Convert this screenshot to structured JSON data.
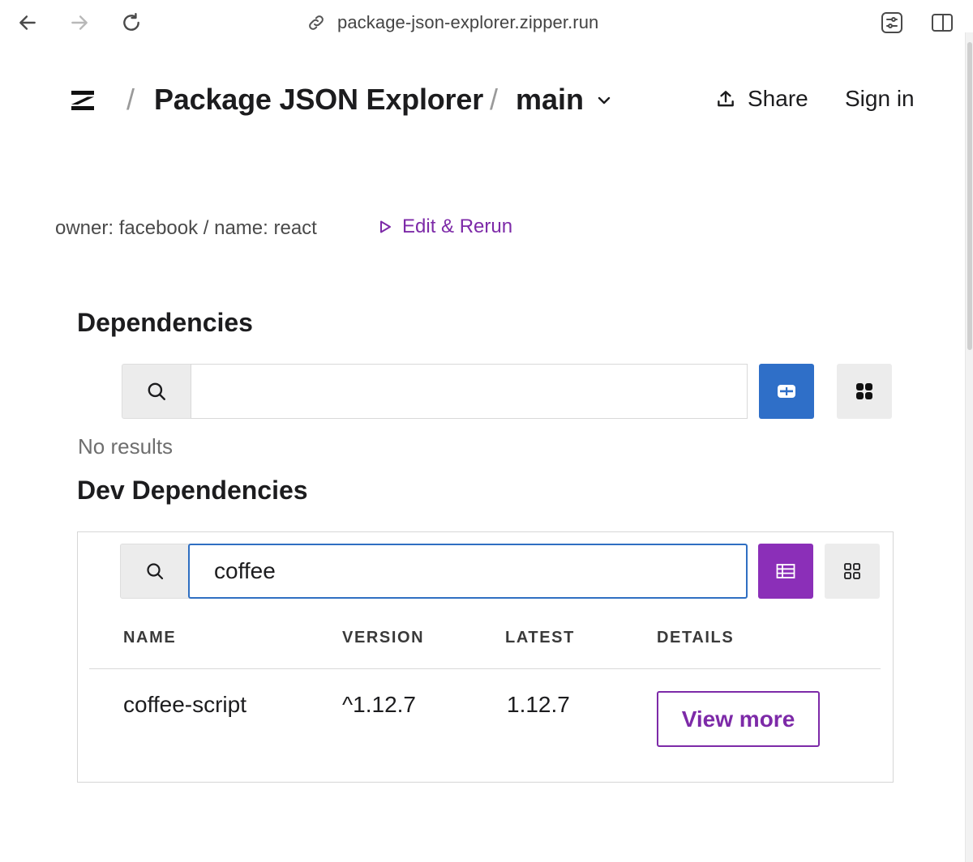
{
  "browser": {
    "url": "package-json-explorer.zipper.run"
  },
  "header": {
    "app_title": "Package JSON Explorer",
    "separator": "/",
    "branch": "main",
    "share_label": "Share",
    "signin_label": "Sign in"
  },
  "inputs": {
    "summary": "owner: facebook / name: react",
    "edit_rerun_label": "Edit & Rerun"
  },
  "dependencies": {
    "title": "Dependencies",
    "search_value": "",
    "no_results": "No results"
  },
  "dev_dependencies": {
    "title": "Dev Dependencies",
    "search_value": "coffee",
    "columns": [
      "NAME",
      "VERSION",
      "LATEST",
      "DETAILS"
    ],
    "rows": [
      {
        "name": "coffee-script",
        "version": "^1.12.7",
        "latest": "1.12.7",
        "details_label": "View more"
      }
    ]
  },
  "colors": {
    "accent_purple": "#7d2aa8",
    "active_blue": "#2f6fc8",
    "active_purple": "#8b2fb8"
  }
}
